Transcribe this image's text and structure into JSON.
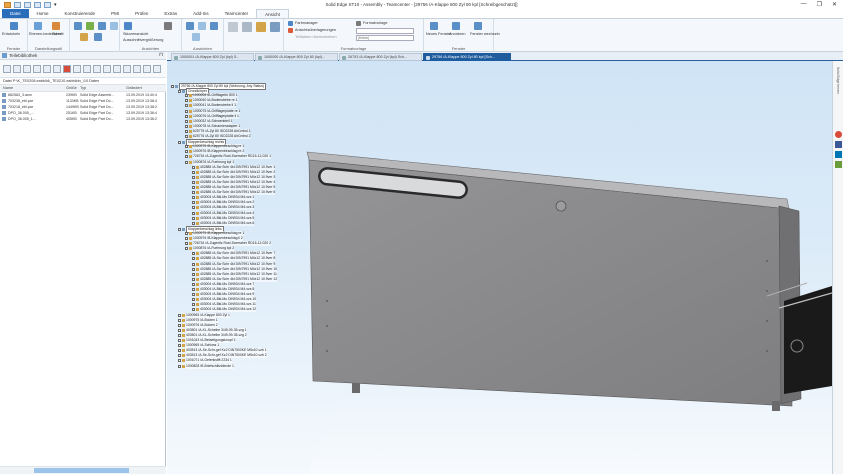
{
  "window": {
    "title": "Solid Edge ST10 - Assembly - Teamcenter - [29756 /A-Klappe 800 Zyl 80 kpl [Schreibgeschützt]]",
    "controls": [
      "—",
      "❐",
      "✕"
    ]
  },
  "menu": {
    "tabs": [
      "Datei",
      "Home",
      "Konstruierende",
      "PMI",
      "Prüfen",
      "Extras",
      "Add-Ins",
      "Teamcenter",
      "Ansicht"
    ],
    "active": "Ansicht"
  },
  "ribbon": {
    "groups": [
      {
        "label": "Fenster",
        "items": [
          "Entwickeln"
        ]
      },
      {
        "label": "Darstellungsstil",
        "items": [
          "Ebenen-bedeckern",
          "Schnitt"
        ]
      },
      {
        "label": "Ansichten",
        "items": [
          "Skizzenansicht",
          "Ausschnittvergrößerung",
          "Standard"
        ]
      },
      {
        "label": "Ausrichten",
        "items": [
          "Oberflächenansicht"
        ]
      },
      {
        "label": "Formatvorlage",
        "items": [
          "Farbmanager",
          "Ansichtsüberlagerungen",
          "Teilfarben überschreiben",
          "Formatvorlage"
        ]
      },
      {
        "label": "Fenster",
        "items": [
          "Neues Fenster",
          "Anordnen",
          "Fenster wechseln"
        ]
      }
    ],
    "style_inputs": [
      "",
      "(Keine)"
    ]
  },
  "left_pane": {
    "title": "Teilebibliothek",
    "path": "Datei P:\\K_TE0208.eabbild\\_TE0210.eabbildn_\\10 Daten",
    "columns": [
      "Name",
      "Größe",
      "Typ",
      "Geändert"
    ],
    "files": [
      {
        "name": "682583_3.asm",
        "size": "239KB",
        "type": "Solid Edge Assemb...",
        "date": "13.09.2019 13:40:4"
      },
      {
        "name": "703238_ebl.par",
        "size": "1133KB",
        "type": "Solid Edge Part Do...",
        "date": "13.09.2019 13:38:4"
      },
      {
        "name": "703218_ebl.par",
        "size": "1449KB",
        "type": "Solid Edge Part Do...",
        "date": "13.09.2019 13:38:2"
      },
      {
        "name": "DPO_36.005_...",
        "size": "251KB",
        "type": "Solid Edge Part Do...",
        "date": "13.09.2019 13:36:4"
      },
      {
        "name": "DPO_36.005_1...",
        "size": "405KB",
        "type": "Solid Edge Part Do...",
        "date": "13.09.2019 13:36:2"
      }
    ]
  },
  "doc_tabs": [
    {
      "label": "1000001 /A-Klappe 800 Zyl (kpl) S...",
      "active": false
    },
    {
      "label": "1000000 /A-Klappe 800 Zyl 80 (kpl)...",
      "active": false
    },
    {
      "label": "26753 /A-Klappe 800 Zyl (kpl) Sch...",
      "active": false
    },
    {
      "label": "29756 /A-Klappe 800 Zyl 80 kpl [Sch...",
      "active": true
    }
  ],
  "tree": [
    {
      "indent": 0,
      "label": "29756 /A-Klappe 800 Zyl 80 kpl (Wohnung, Any Status)",
      "sel": true
    },
    {
      "indent": 1,
      "label": "Grundkörper",
      "sel": true
    },
    {
      "indent": 2,
      "label": "1000005 /A-Grifflagetür 800 1"
    },
    {
      "indent": 2,
      "label": "1000040 /A-Bodenstrebe re 1"
    },
    {
      "indent": 2,
      "label": "1000041 /A-Bodenstrebe li 1"
    },
    {
      "indent": 2,
      "label": "1000075 /A-Grifflagerplatte re 1"
    },
    {
      "indent": 2,
      "label": "1000076 /A-Grifflagerplatte li 1"
    },
    {
      "indent": 2,
      "label": "1000032 /A-Schwenkteil 1"
    },
    {
      "indent": 2,
      "label": "1000078 /A-Scharnieradapter 1"
    },
    {
      "indent": 2,
      "label": "625775 /A-Zyl 80 ISO2228 AirCmbsl 1"
    },
    {
      "indent": 2,
      "label": "625776 /A-Zyl 80 ISO2228 AirCmbsl 2"
    },
    {
      "indent": 1,
      "label": "Klappenbeschlag rechts",
      "sel": true
    },
    {
      "indent": 2,
      "label": "1000975 /B-Klappenbeschlag re 1"
    },
    {
      "indent": 2,
      "label": "1000976 /B-Klappenbeschlag re 2"
    },
    {
      "indent": 2,
      "label": "726734 /A-Zugentlz Rust Zwerraher RD15-12-020 1"
    },
    {
      "indent": 2,
      "label": "1000876 /A-Fuehrung kpl 1"
    },
    {
      "indent": 3,
      "label": "402885 /A-Sw Schr 4kt DIN7991 M4x12 10.9ver 1"
    },
    {
      "indent": 3,
      "label": "402885 /A-Sw Schr 4kt DIN7991 M4x12 10.9ver 2"
    },
    {
      "indent": 3,
      "label": "402885 /A-Sw Schr 4kt DIN7991 M4x12 10.9ver 3"
    },
    {
      "indent": 3,
      "label": "402885 /A-Sw Schr 4kt DIN7991 M4x12 10.9ver 4"
    },
    {
      "indent": 3,
      "label": "402885 /A-Sw Schr 4kt DIN7991 M4x12 10.9ver 5"
    },
    {
      "indent": 3,
      "label": "402885 /A-Sw Schr 4kt DIN7991 M4x12 10.9ver 6"
    },
    {
      "indent": 3,
      "label": "403004 /A-Bkl-Mu DIN934 M4-vzs 1"
    },
    {
      "indent": 3,
      "label": "403004 /A-Bkl-Mu DIN934 M4-vzs 2"
    },
    {
      "indent": 3,
      "label": "403004 /A-Bkl-Mu DIN934 M4-vzs 3"
    },
    {
      "indent": 3,
      "label": "403004 /A-Bkl-Mu DIN934 M4-vzs 4"
    },
    {
      "indent": 3,
      "label": "403004 /A-Bkl-Mu DIN934 M4-vzs 5"
    },
    {
      "indent": 3,
      "label": "403004 /A-Bkl-Mu DIN934 M4-vzs 6"
    },
    {
      "indent": 1,
      "label": "Klappenbeschlag links",
      "sel": true
    },
    {
      "indent": 2,
      "label": "1000975 /B-Klappenbeschlag re 1"
    },
    {
      "indent": 2,
      "label": "1000976 /B-Klappenbeschlag li 2"
    },
    {
      "indent": 2,
      "label": "726734 /A-Zugentlz Rust Zwerraher RD15-12-020 2"
    },
    {
      "indent": 2,
      "label": "1000876 /A-Fuehrung kpl 2"
    },
    {
      "indent": 3,
      "label": "402885 /A-Sw Schr 4kt DIN7991 M4x12 10.9ver 7"
    },
    {
      "indent": 3,
      "label": "402885 /A-Sw Schr 4kt DIN7991 M4x12 10.9ver 8"
    },
    {
      "indent": 3,
      "label": "402885 /A-Sw Schr 4kt DIN7991 M4x12 10.9ver 9"
    },
    {
      "indent": 3,
      "label": "402885 /A-Sw Schr 4kt DIN7991 M4x12 10.9ver 10"
    },
    {
      "indent": 3,
      "label": "402885 /A-Sw Schr 4kt DIN7991 M4x12 10.9ver 11"
    },
    {
      "indent": 3,
      "label": "402885 /A-Sw Schr 4kt DIN7991 M4x12 10.9ver 12"
    },
    {
      "indent": 3,
      "label": "403004 /A-Bkl-Mu DIN934 M4-vzs 7"
    },
    {
      "indent": 3,
      "label": "403004 /A-Bkl-Mu DIN934 M4-vzs 8"
    },
    {
      "indent": 3,
      "label": "403004 /A-Bkl-Mu DIN934 M4-vzs 9"
    },
    {
      "indent": 3,
      "label": "403004 /A-Bkl-Mu DIN934 M4-vzs 10"
    },
    {
      "indent": 3,
      "label": "403004 /A-Bkl-Mu DIN934 M4-vzs 11"
    },
    {
      "indent": 3,
      "label": "403004 /A-Bkl-Mu DIN934 M4-vzs 12"
    },
    {
      "indent": 1,
      "label": "1000965 /A-Klappe 800 Zyl 1"
    },
    {
      "indent": 1,
      "label": "1000975 /A-Bolzen 1"
    },
    {
      "indent": 1,
      "label": "1000976 /A-Bolzen 2"
    },
    {
      "indent": 1,
      "label": "403501 /A-KL-Scheibe 3/49-09-35-vzg 1"
    },
    {
      "indent": 1,
      "label": "403501 /A-KL-Scheibe 3/49-09-35-vzg 2"
    },
    {
      "indent": 1,
      "label": "1001043 /A-Betaetigungsknopf 1"
    },
    {
      "indent": 1,
      "label": "1000965 /A-Schloss 1"
    },
    {
      "indent": 1,
      "label": "403513 /A-Se-Schr-gef Kz2 DIN7500KE M5x10-vzb 1"
    },
    {
      "indent": 1,
      "label": "403513 /A-Se-Schr-gef Kz2 DIN7500KE M5x10-vzb 2"
    },
    {
      "indent": 1,
      "label": "1001071 /A-Gelenkstift 2234 1"
    },
    {
      "indent": 1,
      "label": "1000828 /B-Briefschlitzblende 1"
    }
  ],
  "right_strip": {
    "label": "Solid Edge lernen"
  },
  "colors": {
    "accent": "#1f5c9e",
    "viewport_top": "#cfe4f6",
    "part_metal": "#8c8c8e"
  }
}
